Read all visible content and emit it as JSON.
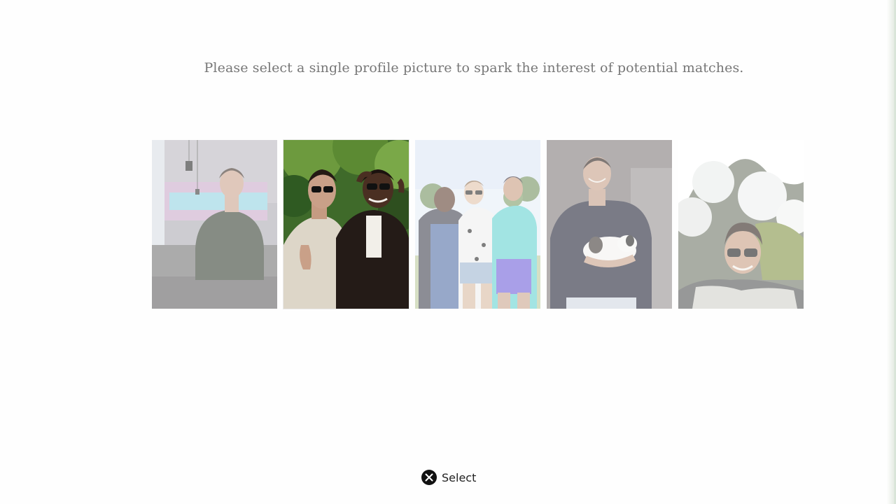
{
  "prompt_text": "Please select a single profile picture to spark the interest of potential matches.",
  "photos": [
    {
      "name": "photo-cafe-portrait",
      "selected": false
    },
    {
      "name": "photo-sunglasses-friends",
      "selected": true
    },
    {
      "name": "photo-festival-group",
      "selected": false
    },
    {
      "name": "photo-holding-puppy",
      "selected": false
    },
    {
      "name": "photo-mountain-selfie",
      "selected": false
    }
  ],
  "button_prompt": {
    "icon": "cross-button-icon",
    "label": "Select"
  },
  "colors": {
    "background": "#fefefe",
    "prompt_text": "#777777",
    "button_icon": "#111111"
  }
}
